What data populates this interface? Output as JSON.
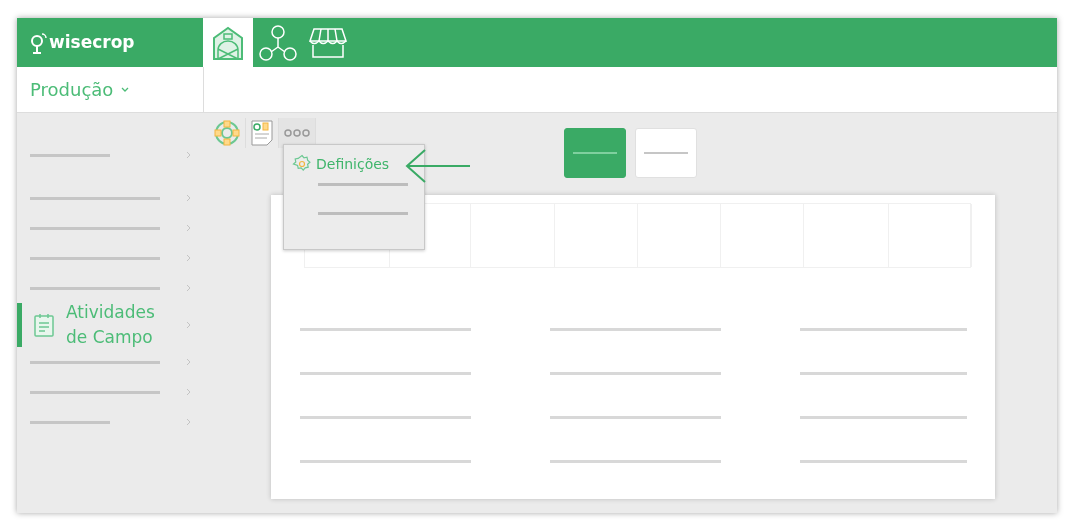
{
  "brand": {
    "name": "wisecrop"
  },
  "tabs": [
    {
      "kind": "barn",
      "selected": true
    },
    {
      "kind": "network",
      "selected": false
    },
    {
      "kind": "market",
      "selected": false
    }
  ],
  "module": {
    "label": "Produção"
  },
  "sidebar": {
    "items": [
      {
        "kind": "stub",
        "selected": false
      },
      {
        "kind": "line",
        "selected": false
      },
      {
        "kind": "line",
        "selected": false
      },
      {
        "kind": "line",
        "selected": false
      },
      {
        "kind": "line",
        "selected": false
      },
      {
        "kind": "label",
        "label": "Atividades de Campo",
        "selected": true
      },
      {
        "kind": "line",
        "selected": false
      },
      {
        "kind": "line",
        "selected": false
      },
      {
        "kind": "stub",
        "selected": false
      }
    ]
  },
  "toolbar": [
    {
      "kind": "lifebuoy"
    },
    {
      "kind": "report"
    },
    {
      "kind": "more",
      "expanded": true
    }
  ],
  "menu": {
    "items": [
      {
        "kind": "label",
        "label": "Definições"
      },
      {
        "kind": "line"
      },
      {
        "kind": "line"
      }
    ]
  },
  "view_toggle": [
    {
      "selected": true
    },
    {
      "selected": false
    }
  ]
}
